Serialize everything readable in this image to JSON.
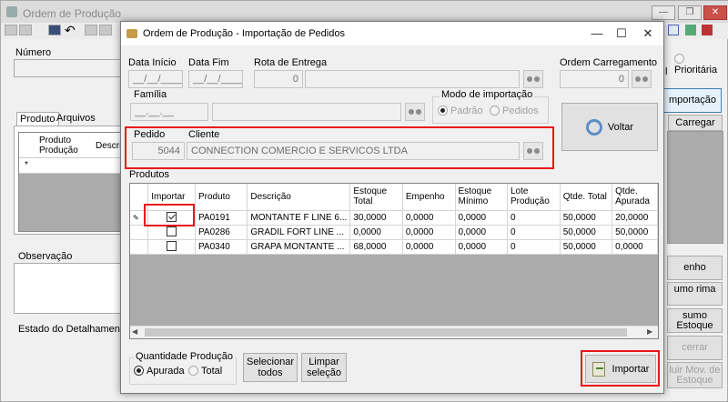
{
  "parent": {
    "title": "Ordem de Produção",
    "numero_label": "Número",
    "tabs": [
      "Produto",
      "Arquivos"
    ],
    "grid_headers": [
      "Produto Produção",
      "Descri"
    ],
    "new_row_marker": "*",
    "observacao_label": "Observação",
    "estado_label": "Estado do Detalhamento",
    "prioritaria_label": "Prioritária",
    "prioritaria_suffix": "l",
    "importacao_button": "mportação",
    "carregar_button": "Carregar",
    "side_buttons": [
      "enho",
      "umo rima",
      "sumo Estoque",
      "cerrar",
      "luir Mov. de Estoque"
    ]
  },
  "dialog": {
    "title": "Ordem de Produção - Importação de Pedidos",
    "data_inicio_label": "Data Início",
    "data_inicio_value": "__/__/____",
    "data_fim_label": "Data Fim",
    "data_fim_value": "__/__/____",
    "rota_label": "Rota de Entrega",
    "rota_code": "0",
    "rota_name": "",
    "ordem_carregamento_label": "Ordem Carregamento",
    "ordem_carregamento_value": "0",
    "familia_label": "Família",
    "familia_code": "__.__.__",
    "familia_name": "",
    "modo_label": "Modo de importação",
    "modo_options": [
      "Padrão",
      "Pedidos"
    ],
    "modo_selected": "Padrão",
    "voltar_label": "Voltar",
    "pedido_label": "Pedido",
    "pedido_value": "5044",
    "cliente_label": "Cliente",
    "cliente_value": "CONNECTION COMERCIO E SERVICOS LTDA",
    "produtos_label": "Produtos",
    "grid": {
      "headers": [
        "Importar",
        "Produto",
        "Descrição",
        "Estoque Total",
        "Empenho",
        "Estoque Mínimo",
        "Lote Produção",
        "Qtde. Total",
        "Qtde. Apurada"
      ],
      "rows": [
        {
          "importar": true,
          "produto": "PA0191",
          "descricao": "MONTANTE F LINE 6...",
          "estoque_total": "30,0000",
          "empenho": "0,0000",
          "estoque_minimo": "0,0000",
          "lote": "0",
          "qtde_total": "50,0000",
          "qtde_apurada": "20,0000"
        },
        {
          "importar": false,
          "produto": "PA0286",
          "descricao": "GRADIL FORT LINE ...",
          "estoque_total": "0,0000",
          "empenho": "0,0000",
          "estoque_minimo": "0,0000",
          "lote": "0",
          "qtde_total": "50,0000",
          "qtde_apurada": "50,0000"
        },
        {
          "importar": false,
          "produto": "PA0340",
          "descricao": "GRAPA MONTANTE ...",
          "estoque_total": "68,0000",
          "empenho": "0,0000",
          "estoque_minimo": "0,0000",
          "lote": "0",
          "qtde_total": "50,0000",
          "qtde_apurada": "0,0000"
        }
      ]
    },
    "quantidade_label": "Quantidade Produção",
    "quantidade_options": [
      "Apurada",
      "Total"
    ],
    "quantidade_selected": "Apurada",
    "selecionar_label": "Selecionar todos",
    "limpar_label": "Limpar seleção",
    "importar_label": "Importar"
  },
  "colors": {
    "highlight": "#e8141a",
    "grid_background": "#ababab"
  }
}
